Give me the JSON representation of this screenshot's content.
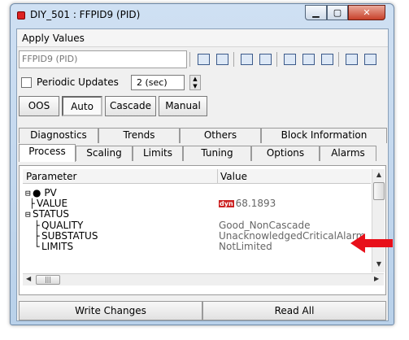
{
  "window": {
    "title": "DIY_501 : FFPID9 (PID)"
  },
  "menu": {
    "apply_values": "Apply Values"
  },
  "toolbar": {
    "tag": "FFPID9 (PID)"
  },
  "options": {
    "periodic_updates": "Periodic Updates",
    "interval": "2 (sec)"
  },
  "modes": [
    "OOS",
    "Auto",
    "Cascade",
    "Manual"
  ],
  "tabs": {
    "row1": [
      "Diagnostics",
      "Trends",
      "Others",
      "Block Information"
    ],
    "row2": [
      "Process",
      "Scaling",
      "Limits",
      "Tuning",
      "Options",
      "Alarms"
    ]
  },
  "grid": {
    "headers": {
      "parameter": "Parameter",
      "value": "Value"
    },
    "rows": [
      {
        "param": "PV",
        "value": ""
      },
      {
        "param": "VALUE",
        "value": "68.1893",
        "badge": "dyn"
      },
      {
        "param": "STATUS",
        "value": ""
      },
      {
        "param": "QUALITY",
        "value": "Good_NonCascade"
      },
      {
        "param": "SUBSTATUS",
        "value": "UnacknowledgedCriticalAlarm"
      },
      {
        "param": "LIMITS",
        "value": "NotLimited"
      }
    ]
  },
  "buttons": {
    "write_changes": "Write Changes",
    "read_all": "Read All"
  },
  "colors": {
    "annotation_arrow": "#e8101a",
    "dyn_badge": "#cc2222"
  }
}
